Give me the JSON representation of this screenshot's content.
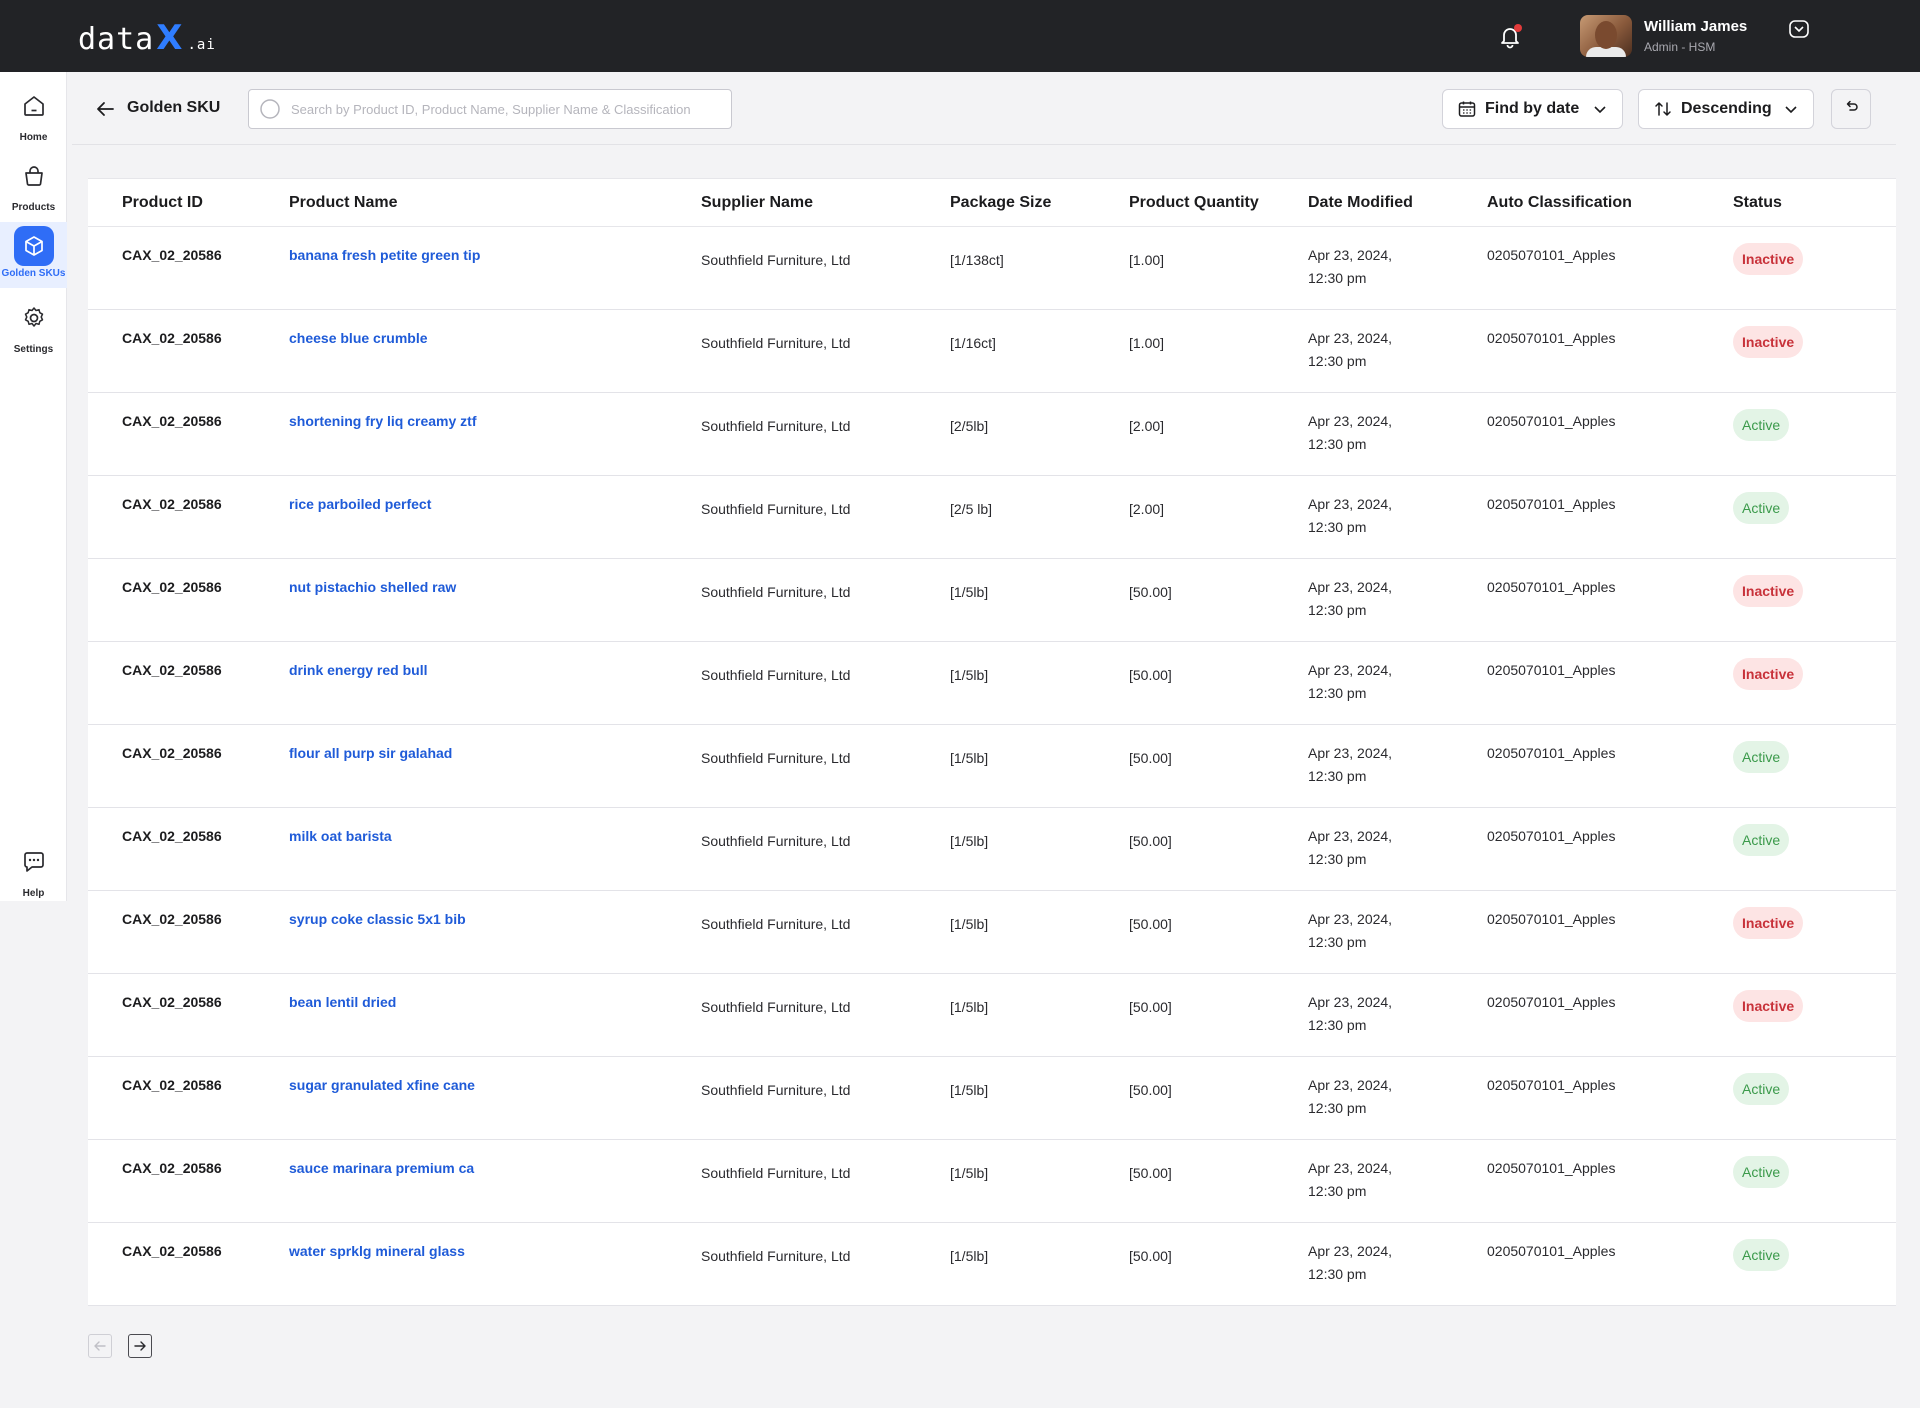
{
  "app": {
    "logo_main": "data",
    "logo_x": "X",
    "logo_suffix": ".ai"
  },
  "user": {
    "name": "William James",
    "role": "Admin - HSM"
  },
  "sidebar": {
    "items": [
      {
        "label": "Home",
        "icon": "home-icon"
      },
      {
        "label": "Products",
        "icon": "bag-icon"
      },
      {
        "label": "Golden SKUs",
        "icon": "cube-icon"
      },
      {
        "label": "Settings",
        "icon": "gear-icon"
      },
      {
        "label": "Help",
        "icon": "chat-icon"
      }
    ],
    "active": "Golden SKUs"
  },
  "header": {
    "title": "Golden SKU",
    "search_placeholder": "Search by Product ID, Product Name, Supplier Name & Classification",
    "date_filter_label": "Find by date",
    "sort_label": "Descending"
  },
  "table": {
    "columns": [
      "Product ID",
      "Product Name",
      "Supplier Name",
      "Package Size",
      "Product Quantity",
      "Date Modified",
      "Auto Classification",
      "Status"
    ],
    "rows": [
      {
        "id": "CAX_02_20586",
        "name": "banana fresh petite green tip",
        "supplier": "Southfield Furniture, Ltd",
        "package": "[1/138ct]",
        "qty": "[1.00]",
        "date": "Apr 23, 2024,",
        "time": "12:30 pm",
        "cls": "0205070101_Apples",
        "status": "Inactive"
      },
      {
        "id": "CAX_02_20586",
        "name": "cheese blue crumble",
        "supplier": "Southfield Furniture, Ltd",
        "package": "[1/16ct]",
        "qty": "[1.00]",
        "date": "Apr 23, 2024,",
        "time": "12:30 pm",
        "cls": "0205070101_Apples",
        "status": "Inactive"
      },
      {
        "id": "CAX_02_20586",
        "name": "shortening fry liq creamy ztf",
        "supplier": "Southfield Furniture, Ltd",
        "package": "[2/5lb]",
        "qty": "[2.00]",
        "date": "Apr 23, 2024,",
        "time": "12:30 pm",
        "cls": "0205070101_Apples",
        "status": "Active"
      },
      {
        "id": "CAX_02_20586",
        "name": "rice parboiled perfect",
        "supplier": "Southfield Furniture, Ltd",
        "package": "[2/5 lb]",
        "qty": "[2.00]",
        "date": "Apr 23, 2024,",
        "time": "12:30 pm",
        "cls": "0205070101_Apples",
        "status": "Active"
      },
      {
        "id": "CAX_02_20586",
        "name": "nut pistachio shelled raw",
        "supplier": "Southfield Furniture, Ltd",
        "package": "[1/5lb]",
        "qty": "[50.00]",
        "date": "Apr 23, 2024,",
        "time": "12:30 pm",
        "cls": "0205070101_Apples",
        "status": "Inactive"
      },
      {
        "id": "CAX_02_20586",
        "name": "drink energy red bull",
        "supplier": "Southfield Furniture, Ltd",
        "package": "[1/5lb]",
        "qty": "[50.00]",
        "date": "Apr 23, 2024,",
        "time": "12:30 pm",
        "cls": "0205070101_Apples",
        "status": "Inactive"
      },
      {
        "id": "CAX_02_20586",
        "name": "flour all purp sir galahad",
        "supplier": "Southfield Furniture, Ltd",
        "package": "[1/5lb]",
        "qty": "[50.00]",
        "date": "Apr 23, 2024,",
        "time": "12:30 pm",
        "cls": "0205070101_Apples",
        "status": "Active"
      },
      {
        "id": "CAX_02_20586",
        "name": "milk oat barista",
        "supplier": "Southfield Furniture, Ltd",
        "package": "[1/5lb]",
        "qty": "[50.00]",
        "date": "Apr 23, 2024,",
        "time": "12:30 pm",
        "cls": "0205070101_Apples",
        "status": "Active"
      },
      {
        "id": "CAX_02_20586",
        "name": "syrup coke classic 5x1 bib",
        "supplier": "Southfield Furniture, Ltd",
        "package": "[1/5lb]",
        "qty": "[50.00]",
        "date": "Apr 23, 2024,",
        "time": "12:30 pm",
        "cls": "0205070101_Apples",
        "status": "Inactive"
      },
      {
        "id": "CAX_02_20586",
        "name": "bean lentil dried",
        "supplier": "Southfield Furniture, Ltd",
        "package": "[1/5lb]",
        "qty": "[50.00]",
        "date": "Apr 23, 2024,",
        "time": "12:30 pm",
        "cls": "0205070101_Apples",
        "status": "Inactive"
      },
      {
        "id": "CAX_02_20586",
        "name": "sugar granulated xfine cane",
        "supplier": "Southfield Furniture, Ltd",
        "package": "[1/5lb]",
        "qty": "[50.00]",
        "date": "Apr 23, 2024,",
        "time": "12:30 pm",
        "cls": "0205070101_Apples",
        "status": "Active"
      },
      {
        "id": "CAX_02_20586",
        "name": "sauce marinara premium ca",
        "supplier": "Southfield Furniture, Ltd",
        "package": "[1/5lb]",
        "qty": "[50.00]",
        "date": "Apr 23, 2024,",
        "time": "12:30 pm",
        "cls": "0205070101_Apples",
        "status": "Active"
      },
      {
        "id": "CAX_02_20586",
        "name": "water sprklg mineral glass",
        "supplier": "Southfield Furniture, Ltd",
        "package": "[1/5lb]",
        "qty": "[50.00]",
        "date": "Apr 23, 2024,",
        "time": "12:30 pm",
        "cls": "0205070101_Apples",
        "status": "Active"
      }
    ]
  },
  "colors": {
    "accent": "#2f6df6",
    "link": "#1f5bd8",
    "active_bg": "#e3f4e6",
    "active_fg": "#3b9a4b",
    "inactive_bg": "#fde4e4",
    "inactive_fg": "#c8323a",
    "topbar": "#222326"
  }
}
